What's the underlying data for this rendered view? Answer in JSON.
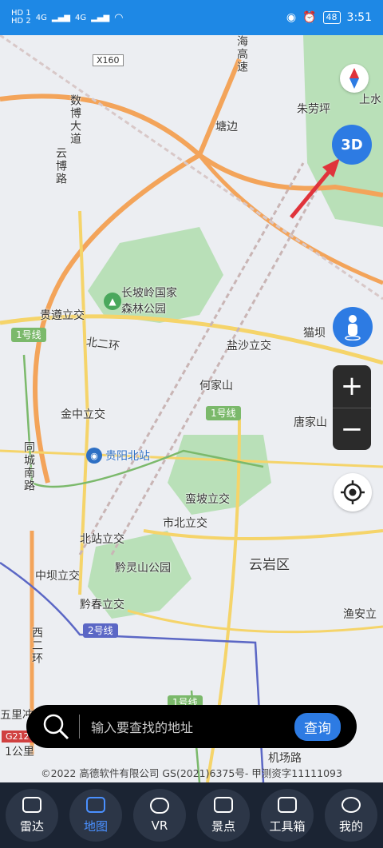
{
  "status_bar": {
    "hd1": "HD 1",
    "hd2": "HD 2",
    "net1": "4G",
    "net2": "4G",
    "battery": "48",
    "time": "3:51"
  },
  "map": {
    "labels": {
      "x160": "X160",
      "haigao_speed": "海高速",
      "zhulaoping": "朱劳坪",
      "shangshui": "上水",
      "tangbian": "塘边",
      "shubo_road": "数博大道",
      "yunbo_road": "云博路",
      "changpoling": "长坡岭国家",
      "forest_park": "森林公园",
      "guizun": "贵遵立交",
      "beierhuan": "北二环",
      "yanshan": "盐沙立交",
      "maoba": "猫坝",
      "hejiashan": "何家山",
      "jinzhong": "金中立交",
      "tangjiashan": "唐家山",
      "tongcheng": "同城南路",
      "guiyang_north": "贵阳北站",
      "manpo": "蛮坡立交",
      "shibei": "市北立交",
      "beizhan": "北站立交",
      "yunyan": "云岩区",
      "qianling": "黔灵山公园",
      "zhongba": "中坝立交",
      "qianchun": "黔春立交",
      "yuan": "渔安立",
      "xierhuan": "西二环",
      "wulihe": "五里冲",
      "one_km": "1公里",
      "jichang": "机场路"
    },
    "metro": {
      "line1": "1号线",
      "line1b": "1号线",
      "line2": "2号线",
      "line1c": "1号线"
    },
    "roads": {
      "g212": "G212"
    }
  },
  "controls": {
    "btn_3d": "3D",
    "zoom_in": "+",
    "zoom_out": "−"
  },
  "search": {
    "placeholder": "输入要查找的地址",
    "button": "查询"
  },
  "copyright": "©2022 高德软件有限公司 GS(2021)6375号- 甲测资字11111093",
  "tabs": [
    {
      "label": "雷达",
      "icon": "radar-icon"
    },
    {
      "label": "地图",
      "icon": "map-icon"
    },
    {
      "label": "VR",
      "icon": "vr-icon"
    },
    {
      "label": "景点",
      "icon": "scenic-icon"
    },
    {
      "label": "工具箱",
      "icon": "toolbox-icon"
    },
    {
      "label": "我的",
      "icon": "profile-icon"
    }
  ]
}
